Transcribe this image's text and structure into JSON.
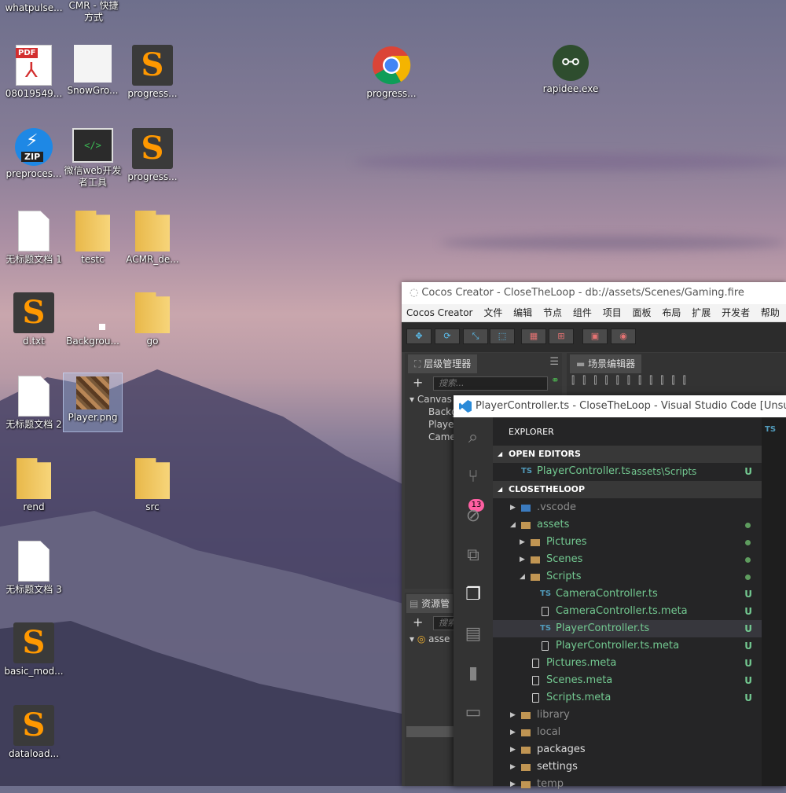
{
  "desktop": {
    "icons": [
      {
        "label": "whatpulse..."
      },
      {
        "label": "CMR - 快捷方式"
      },
      {
        "label": "08019549..."
      },
      {
        "label": "SnowGro..."
      },
      {
        "label": "progress..."
      },
      {
        "label": "progress..."
      },
      {
        "label": "rapidee.exe"
      },
      {
        "label": "preproces..."
      },
      {
        "label": "微信web开发者工具"
      },
      {
        "label": "progress..."
      },
      {
        "label": "无标题文档 1"
      },
      {
        "label": "testc"
      },
      {
        "label": "ACMR_de..."
      },
      {
        "label": "d.txt"
      },
      {
        "label": "Backgrou..."
      },
      {
        "label": "go"
      },
      {
        "label": "无标题文档 2"
      },
      {
        "label": "Player.png"
      },
      {
        "label": "rend"
      },
      {
        "label": "src"
      },
      {
        "label": "无标题文档 3"
      },
      {
        "label": "basic_mod..."
      },
      {
        "label": "dataload..."
      }
    ],
    "pdf_tag": "PDF",
    "zip_tag": "ZIP",
    "sublime_glyph": "S",
    "code_glyph": "</>"
  },
  "cocos": {
    "title": "Cocos Creator - CloseTheLoop - db://assets/Scenes/Gaming.fire",
    "menu": [
      "Cocos Creator",
      "文件",
      "编辑",
      "节点",
      "组件",
      "项目",
      "面板",
      "布局",
      "扩展",
      "开发者",
      "帮助"
    ],
    "hierarchy_tab": "层级管理器",
    "scene_tab": "场景编辑器",
    "search_placeholder": "搜索...",
    "tree": [
      "Canvas",
      "Backg",
      "Playe",
      "Came"
    ],
    "assets_tab": "资源管",
    "assets_search": "搜索",
    "assets_tree": [
      "asse"
    ]
  },
  "vscode": {
    "title": "PlayerController.ts - CloseTheLoop - Visual Studio Code [Unsupported]",
    "explorer_label": "EXPLORER",
    "editor_tab_badge": "TS",
    "scm_badge": "13",
    "open_editors_label": "OPEN EDITORS",
    "open_editor": {
      "icon": "TS",
      "name": "PlayerController.ts",
      "path": "assets\\Scripts",
      "status": "U"
    },
    "project_label": "CLOSETHELOOP",
    "tree": [
      {
        "name": ".vscode",
        "kind": "folder",
        "indent": 0,
        "twisty": "▶",
        "color": "grey",
        "status": ""
      },
      {
        "name": "assets",
        "kind": "folder",
        "indent": 0,
        "twisty": "◢",
        "color": "green",
        "status": "dot"
      },
      {
        "name": "Pictures",
        "kind": "folder",
        "indent": 1,
        "twisty": "▶",
        "color": "green",
        "status": "dot"
      },
      {
        "name": "Scenes",
        "kind": "folder",
        "indent": 1,
        "twisty": "▶",
        "color": "green",
        "status": "dot"
      },
      {
        "name": "Scripts",
        "kind": "folder",
        "indent": 1,
        "twisty": "◢",
        "color": "green",
        "status": "dot"
      },
      {
        "name": "CameraController.ts",
        "kind": "ts",
        "indent": 2,
        "twisty": "",
        "color": "green",
        "status": "U"
      },
      {
        "name": "CameraController.ts.meta",
        "kind": "file",
        "indent": 2,
        "twisty": "",
        "color": "green",
        "status": "U"
      },
      {
        "name": "PlayerController.ts",
        "kind": "ts",
        "indent": 2,
        "twisty": "",
        "color": "green",
        "status": "U",
        "selected": true
      },
      {
        "name": "PlayerController.ts.meta",
        "kind": "file",
        "indent": 2,
        "twisty": "",
        "color": "green",
        "status": "U"
      },
      {
        "name": "Pictures.meta",
        "kind": "file",
        "indent": 1,
        "twisty": "",
        "color": "green",
        "status": "U"
      },
      {
        "name": "Scenes.meta",
        "kind": "file",
        "indent": 1,
        "twisty": "",
        "color": "green",
        "status": "U"
      },
      {
        "name": "Scripts.meta",
        "kind": "file",
        "indent": 1,
        "twisty": "",
        "color": "green",
        "status": "U"
      },
      {
        "name": "library",
        "kind": "folder",
        "indent": 0,
        "twisty": "▶",
        "color": "grey",
        "status": ""
      },
      {
        "name": "local",
        "kind": "folder",
        "indent": 0,
        "twisty": "▶",
        "color": "grey",
        "status": ""
      },
      {
        "name": "packages",
        "kind": "folder",
        "indent": 0,
        "twisty": "▶",
        "color": "white",
        "status": ""
      },
      {
        "name": "settings",
        "kind": "folder",
        "indent": 0,
        "twisty": "▶",
        "color": "white",
        "status": ""
      },
      {
        "name": "temp",
        "kind": "folder",
        "indent": 0,
        "twisty": "▶",
        "color": "grey",
        "status": ""
      }
    ],
    "colors": {
      "green": "#73c991",
      "grey": "#8c8c8c",
      "white": "#dddddd",
      "ts": "#519aba",
      "folder": "#c09553"
    }
  }
}
